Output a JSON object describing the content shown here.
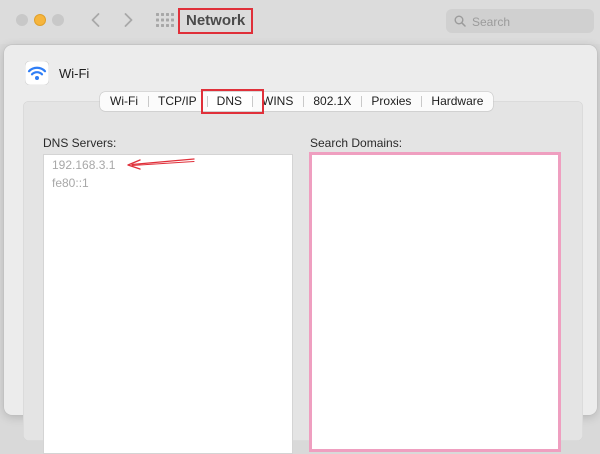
{
  "window": {
    "title": "Network",
    "search_placeholder": "Search"
  },
  "interface": {
    "name": "Wi-Fi"
  },
  "tabs": [
    {
      "label": "Wi-Fi"
    },
    {
      "label": "TCP/IP"
    },
    {
      "label": "DNS",
      "selected": true
    },
    {
      "label": "WINS"
    },
    {
      "label": "802.1X"
    },
    {
      "label": "Proxies"
    },
    {
      "label": "Hardware"
    }
  ],
  "dns": {
    "servers_label": "DNS Servers:",
    "servers": [
      "192.168.3.1",
      "fe80::1"
    ],
    "search_domains_label": "Search Domains:",
    "search_domains": []
  },
  "colors": {
    "annotation_red": "#e0303a",
    "search_domains_border": "#ef9fc0",
    "wifi_blue": "#2f7ef6"
  }
}
